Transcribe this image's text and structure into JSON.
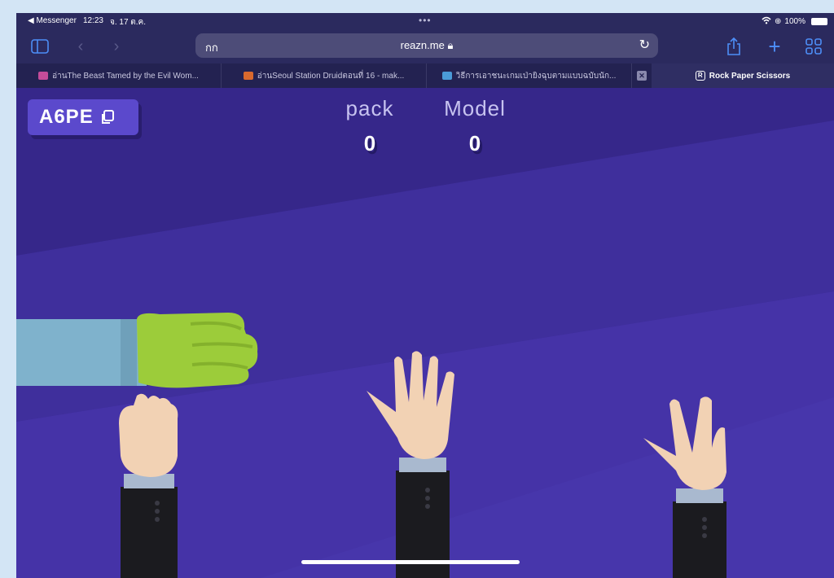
{
  "status_bar": {
    "back_app": "◀ Messenger",
    "time": "12:23",
    "date": "จ. 17 ต.ค.",
    "battery": "100%"
  },
  "toolbar": {
    "language_toggle": "กก",
    "url": "reazn.me",
    "icons": [
      "sidebar-icon",
      "back-icon",
      "forward-icon",
      "reload-icon",
      "share-icon",
      "new-tab-icon",
      "tab-overview-icon"
    ]
  },
  "tabs": [
    {
      "label": "อ่านThe Beast Tamed by the Evil Wom...",
      "favicon_color": "#c44c9a"
    },
    {
      "label": "อ่านSeoul Station Druidตอนที่ 16 - mak...",
      "favicon_color": "#d9692e"
    },
    {
      "label": "วิธีการเอาชนะเกมเป่ายิงฉุบตามแบบฉบับนัก...",
      "favicon_color": "#4b9bd8"
    },
    {
      "label": "Rock Paper Scissors",
      "favicon_label": "R",
      "active": true
    }
  ],
  "game": {
    "room_code": "A6PE",
    "scores": [
      {
        "name": "pack",
        "value": "0"
      },
      {
        "name": "Model",
        "value": "0"
      }
    ],
    "player_choice": "rock",
    "options": [
      "rock",
      "paper",
      "scissors"
    ],
    "colors": {
      "background": "#3b2b94",
      "stripe": "#4a38a8",
      "player_sleeve": "#7fb2cc",
      "player_hand": "#9ccc3a",
      "option_skin": "#f2d2b4",
      "option_sleeve": "#1b1b1f",
      "cuff": "#a9b9cf"
    }
  }
}
